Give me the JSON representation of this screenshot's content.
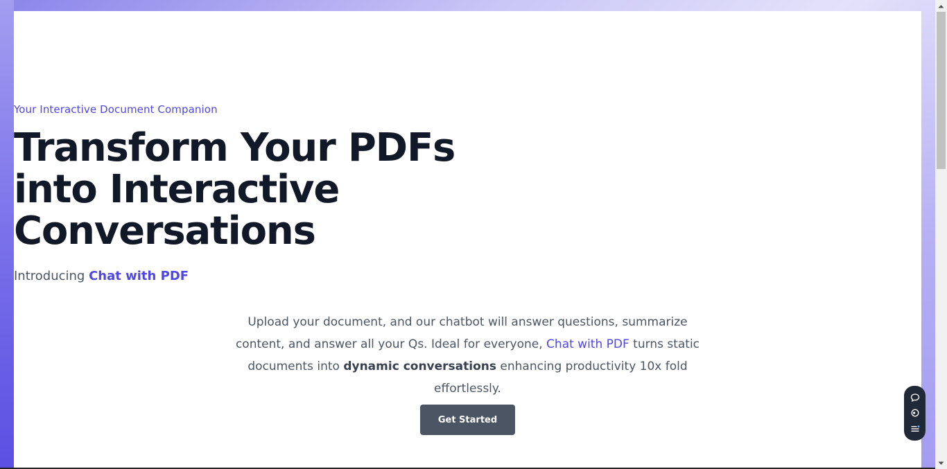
{
  "hero": {
    "tagline": "Your Interactive Document Companion",
    "headline_lines": [
      "Transform Your PDFs",
      "into Interactive",
      "Conversations"
    ],
    "intro_prefix": "Introducing ",
    "intro_brand": "Chat with PDF",
    "desc_part1": "Upload your document, and our chatbot will answer questions, summarize content, and answer all your Qs. Ideal for everyone, ",
    "desc_link": "Chat with PDF",
    "desc_part2": " turns static documents into ",
    "desc_bold": "dynamic conversations",
    "desc_part3": " enhancing productivity 10x fold effortlessly.",
    "cta_label": "Get Started"
  },
  "floating_toolbar": {
    "icons": [
      "chat-bubble-icon",
      "screen-capture-icon",
      "list-menu-icon"
    ]
  },
  "colors": {
    "accent": "#4f46e5",
    "heading": "#111827",
    "body_text": "#4b5563",
    "button_bg": "#4b5563"
  }
}
